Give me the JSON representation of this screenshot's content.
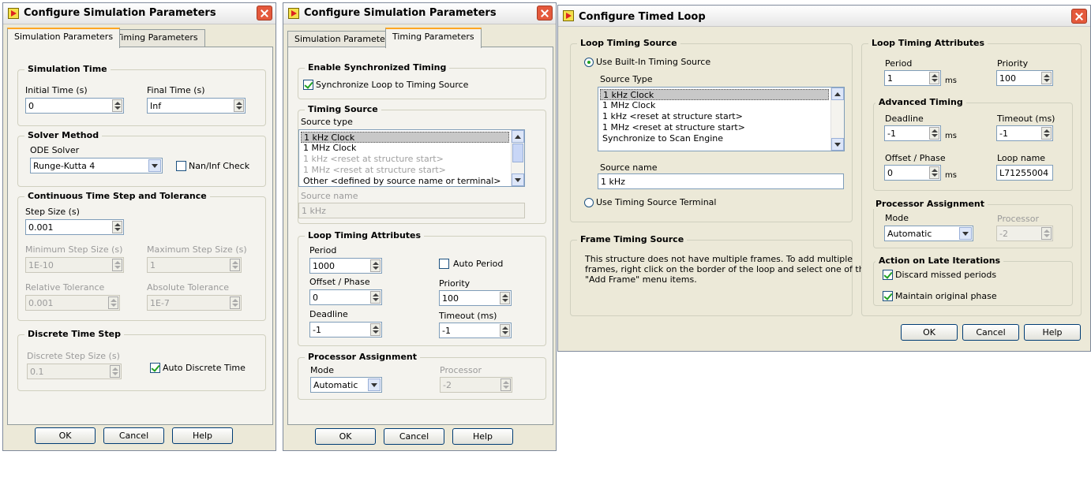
{
  "dialog1": {
    "title": "Configure Simulation Parameters",
    "tabs": [
      "Simulation Parameters",
      "Timing Parameters"
    ],
    "simulation_time": {
      "title": "Simulation Time",
      "initial_label": "Initial Time (s)",
      "initial_value": "0",
      "final_label": "Final Time (s)",
      "final_value": "Inf"
    },
    "solver": {
      "title": "Solver Method",
      "ode_label": "ODE Solver",
      "ode_value": "Runge-Kutta 4",
      "nan_label": "Nan/Inf Check"
    },
    "continuous": {
      "title": "Continuous Time Step and Tolerance",
      "step_label": "Step Size (s)",
      "step_value": "0.001",
      "min_label": "Minimum Step Size (s)",
      "min_value": "1E-10",
      "max_label": "Maximum Step Size (s)",
      "max_value": "1",
      "rel_label": "Relative Tolerance",
      "rel_value": "0.001",
      "abs_label": "Absolute Tolerance",
      "abs_value": "1E-7"
    },
    "discrete": {
      "title": "Discrete Time Step",
      "step_label": "Discrete Step Size (s)",
      "step_value": "0.1",
      "auto_label": "Auto Discrete Time"
    },
    "buttons": {
      "ok": "OK",
      "cancel": "Cancel",
      "help": "Help"
    }
  },
  "dialog2": {
    "title": "Configure Simulation Parameters",
    "tabs": [
      "Simulation Parameters",
      "Timing Parameters"
    ],
    "sync": {
      "title": "Enable Synchronized Timing",
      "check_label": "Synchronize Loop to Timing Source"
    },
    "timing_source": {
      "title": "Timing Source",
      "type_label": "Source type",
      "items": [
        "1 kHz Clock",
        "1 MHz Clock",
        "1 kHz <reset at structure start>",
        "1 MHz <reset at structure start>",
        "Other <defined by source name or terminal>"
      ],
      "name_label": "Source name",
      "name_value": "1 kHz"
    },
    "loop": {
      "title": "Loop Timing Attributes",
      "period_label": "Period",
      "period_value": "1000",
      "auto_label": "Auto Period",
      "offset_label": "Offset / Phase",
      "offset_value": "0",
      "priority_label": "Priority",
      "priority_value": "100",
      "deadline_label": "Deadline",
      "deadline_value": "-1",
      "timeout_label": "Timeout (ms)",
      "timeout_value": "-1"
    },
    "processor": {
      "title": "Processor Assignment",
      "mode_label": "Mode",
      "mode_value": "Automatic",
      "proc_label": "Processor",
      "proc_value": "-2"
    },
    "buttons": {
      "ok": "OK",
      "cancel": "Cancel",
      "help": "Help"
    }
  },
  "dialog3": {
    "title": "Configure Timed Loop",
    "loop_source": {
      "title": "Loop Timing Source",
      "builtin_label": "Use Built-In Timing Source",
      "type_label": "Source Type",
      "items": [
        "1 kHz Clock",
        "1 MHz Clock",
        "1 kHz <reset at structure start>",
        "1 MHz <reset at structure start>",
        "Synchronize to Scan Engine"
      ],
      "name_label": "Source name",
      "name_value": "1 kHz",
      "terminal_label": "Use Timing Source Terminal"
    },
    "frame": {
      "title": "Frame Timing Source",
      "text": [
        "This structure does not have multiple frames. To add multiple",
        "frames, right click on the border of the loop and select one of the",
        "\"Add Frame\" menu items."
      ]
    },
    "attributes": {
      "title": "Loop Timing Attributes",
      "period_label": "Period",
      "period_value": "1",
      "period_unit": "ms",
      "priority_label": "Priority",
      "priority_value": "100"
    },
    "advanced": {
      "title": "Advanced Timing",
      "deadline_label": "Deadline",
      "deadline_value": "-1",
      "deadline_unit": "ms",
      "timeout_label": "Timeout (ms)",
      "timeout_value": "-1",
      "offset_label": "Offset / Phase",
      "offset_value": "0",
      "offset_unit": "ms",
      "name_label": "Loop name",
      "name_value": "L71255004"
    },
    "processor": {
      "title": "Processor Assignment",
      "mode_label": "Mode",
      "mode_value": "Automatic",
      "proc_label": "Processor",
      "proc_value": "-2"
    },
    "late": {
      "title": "Action on Late Iterations",
      "discard_label": "Discard missed periods",
      "maintain_label": "Maintain original phase"
    },
    "buttons": {
      "ok": "OK",
      "cancel": "Cancel",
      "help": "Help"
    }
  }
}
